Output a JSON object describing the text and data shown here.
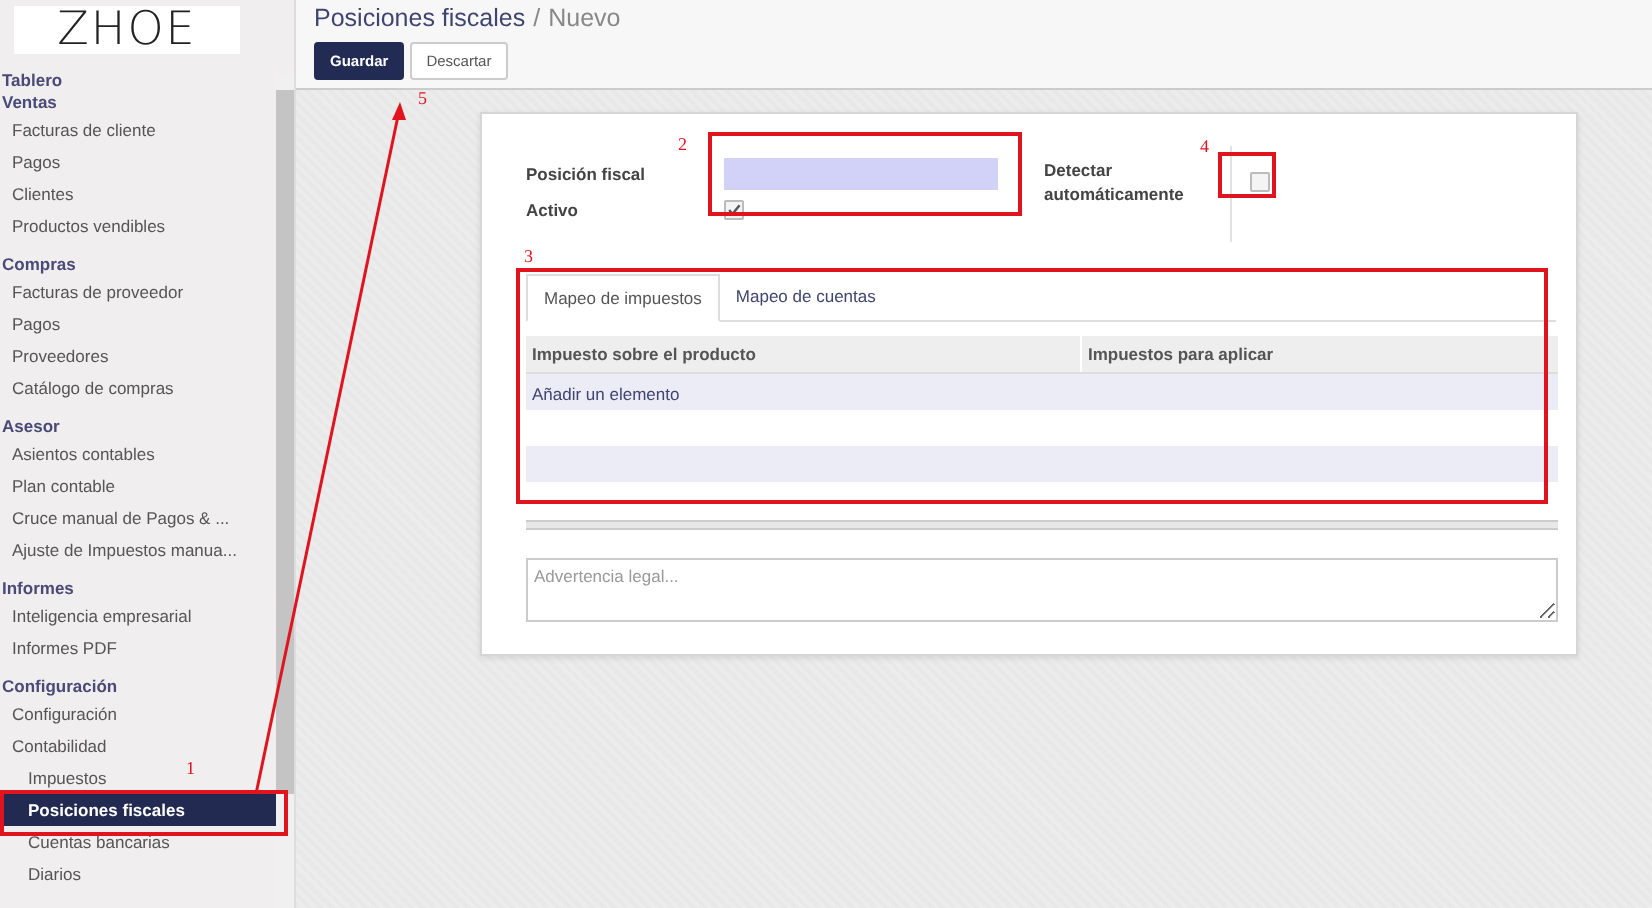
{
  "logo": "ZHOE",
  "sidebar": {
    "sections": [
      {
        "title": "Tablero"
      },
      {
        "title": "Ventas",
        "items": [
          {
            "label": "Facturas de cliente",
            "selected": false
          },
          {
            "label": "Pagos",
            "selected": false
          },
          {
            "label": "Clientes",
            "selected": false
          },
          {
            "label": "Productos vendibles",
            "selected": false
          }
        ]
      },
      {
        "title": "Compras",
        "items": [
          {
            "label": "Facturas de proveedor",
            "selected": false
          },
          {
            "label": "Pagos",
            "selected": false
          },
          {
            "label": "Proveedores",
            "selected": false
          },
          {
            "label": "Catálogo de compras",
            "selected": false
          }
        ]
      },
      {
        "title": "Asesor",
        "items": [
          {
            "label": "Asientos contables",
            "selected": false
          },
          {
            "label": "Plan contable",
            "selected": false
          },
          {
            "label": "Cruce manual de Pagos & ...",
            "selected": false
          },
          {
            "label": "Ajuste de Impuestos manua...",
            "selected": false
          }
        ]
      },
      {
        "title": "Informes",
        "items": [
          {
            "label": "Inteligencia empresarial",
            "selected": false
          },
          {
            "label": "Informes PDF",
            "selected": false
          }
        ]
      },
      {
        "title": "Configuración",
        "items": [
          {
            "label": "Configuración",
            "selected": false
          },
          {
            "label": "Contabilidad",
            "selected": false,
            "children": [
              {
                "label": "Impuestos",
                "selected": false
              },
              {
                "label": "Posiciones fiscales",
                "selected": true
              },
              {
                "label": "Cuentas bancarias",
                "selected": false
              },
              {
                "label": "Diarios",
                "selected": false
              }
            ]
          }
        ]
      }
    ]
  },
  "breadcrumb": {
    "parent": "Posiciones fiscales",
    "separator": "/",
    "current": "Nuevo"
  },
  "buttons": [
    {
      "label": "Guardar",
      "kind": "primary"
    },
    {
      "label": "Descartar",
      "kind": "secondary"
    }
  ],
  "form": {
    "fiscal_position": {
      "label": "Posición fiscal"
    },
    "active": {
      "label": "Activo",
      "checked": true
    },
    "auto_detect": {
      "label": "Detectar automáticamente",
      "checked": false
    }
  },
  "tabs": [
    {
      "label": "Mapeo de impuestos",
      "selected": true
    },
    {
      "label": "Mapeo de cuentas",
      "selected": false
    }
  ],
  "table": {
    "columns": [
      "Impuesto sobre el producto",
      "Impuestos para aplicar"
    ],
    "add_link": "Añadir un elemento"
  },
  "legal_note": {
    "placeholder": "Advertencia legal..."
  },
  "annotations": [
    {
      "label": "1"
    },
    {
      "label": "2"
    },
    {
      "label": "3"
    },
    {
      "label": "4"
    },
    {
      "label": "5"
    }
  ]
}
